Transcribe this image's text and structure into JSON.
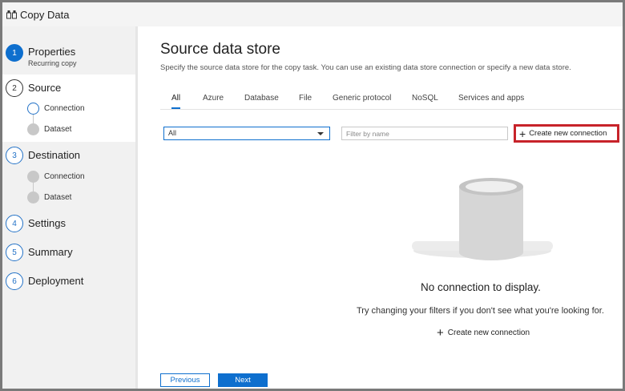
{
  "window": {
    "title": "Copy Data",
    "icon": "copy-data-app-icon"
  },
  "sidebar": {
    "steps": [
      {
        "number": "1",
        "label": "Properties",
        "sublabel": "Recurring copy",
        "state": "complete"
      },
      {
        "number": "2",
        "label": "Source",
        "state": "current",
        "substeps": [
          {
            "label": "Connection",
            "state": "current"
          },
          {
            "label": "Dataset",
            "state": "pending"
          }
        ]
      },
      {
        "number": "3",
        "label": "Destination",
        "state": "pending",
        "substeps": [
          {
            "label": "Connection",
            "state": "pending"
          },
          {
            "label": "Dataset",
            "state": "pending"
          }
        ]
      },
      {
        "number": "4",
        "label": "Settings",
        "state": "pending"
      },
      {
        "number": "5",
        "label": "Summary",
        "state": "pending"
      },
      {
        "number": "6",
        "label": "Deployment",
        "state": "pending"
      }
    ]
  },
  "main": {
    "title": "Source data store",
    "description": "Specify the source data store for the copy task. You can use an existing data store connection or specify a new data store.",
    "tabs": [
      {
        "label": "All",
        "active": true
      },
      {
        "label": "Azure"
      },
      {
        "label": "Database"
      },
      {
        "label": "File"
      },
      {
        "label": "Generic protocol"
      },
      {
        "label": "NoSQL"
      },
      {
        "label": "Services and apps"
      }
    ],
    "filter_select": {
      "value": "All"
    },
    "filter_name": {
      "placeholder": "Filter by name"
    },
    "create_button": {
      "label": "Create new connection",
      "icon": "plus-icon"
    },
    "empty_state": {
      "icon": "database-cylinder-icon",
      "title": "No connection to display.",
      "hint": "Try changing your filters if you don't see what you're looking for.",
      "create_link": "Create new connection"
    },
    "footer": {
      "previous": "Previous",
      "next": "Next"
    }
  },
  "colors": {
    "accent": "#0e6fce",
    "highlight_border": "#c7232a",
    "sidebar_bg": "#f1f1f1"
  }
}
